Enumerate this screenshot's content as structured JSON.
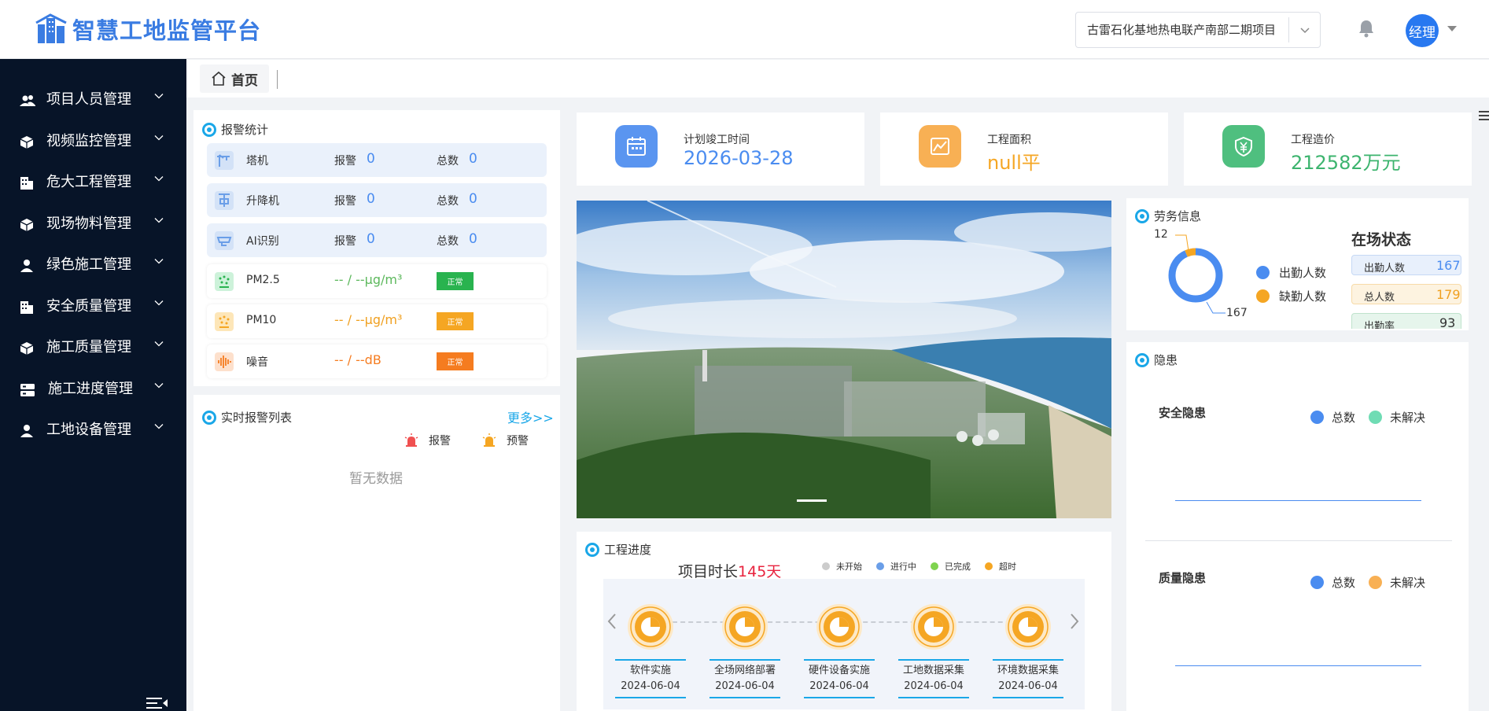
{
  "header": {
    "logo_text": "智慧工地监管平台",
    "project_name": "古雷石化基地热电联产南部二期项目",
    "user_avatar": "经理"
  },
  "sidebar": {
    "items": [
      {
        "label": "项目人员管理",
        "icon": "people-icon"
      },
      {
        "label": "视频监控管理",
        "icon": "cube-icon"
      },
      {
        "label": "危大工程管理",
        "icon": "building-icon"
      },
      {
        "label": "现场物料管理",
        "icon": "cube-icon"
      },
      {
        "label": "绿色施工管理",
        "icon": "person-icon"
      },
      {
        "label": "安全质量管理",
        "icon": "building-icon"
      },
      {
        "label": "施工质量管理",
        "icon": "cube-icon"
      },
      {
        "label": "施工进度管理",
        "icon": "server-icon"
      },
      {
        "label": "工地设备管理",
        "icon": "person-icon"
      }
    ]
  },
  "tabs": {
    "home": "首页"
  },
  "alarm_stats": {
    "title": "报警统计",
    "rows": [
      {
        "name": "塔机",
        "alarm_label": "报警",
        "alarm": "0",
        "total_label": "总数",
        "total": "0"
      },
      {
        "name": "升降机",
        "alarm_label": "报警",
        "alarm": "0",
        "total_label": "总数",
        "total": "0"
      },
      {
        "name": "AI识别",
        "alarm_label": "报警",
        "alarm": "0",
        "total_label": "总数",
        "total": "0"
      }
    ],
    "env": [
      {
        "name": "PM2.5",
        "value": "-- / --μg/m³",
        "status": "正常",
        "value_color": "#5cb85c",
        "badge_color": "#29b34f"
      },
      {
        "name": "PM10",
        "value": "-- / --μg/m³",
        "status": "正常",
        "value_color": "#f0a020",
        "badge_color": "#f5a623"
      },
      {
        "name": "噪音",
        "value": "-- / --dB",
        "status": "正常",
        "value_color": "#f57c20",
        "badge_color": "#f57c20"
      }
    ]
  },
  "realtime": {
    "title": "实时报警列表",
    "more": "更多>>",
    "legend_alarm": "报警",
    "legend_warn": "预警",
    "empty": "暂无数据"
  },
  "stats": [
    {
      "label": "计划竣工时间",
      "value": "2026-03-28",
      "color": "#4a8cf0"
    },
    {
      "label": "工程面积",
      "value": "null平",
      "color": "#f5a623"
    },
    {
      "label": "工程造价",
      "value": "212582万元",
      "color": "#3cb46e"
    }
  ],
  "labor": {
    "title": "劳务信息",
    "donut_top": "12",
    "donut_bottom": "167",
    "legend_present": "出勤人数",
    "legend_absent": "缺勤人数",
    "status_title": "在场状态",
    "rows": [
      {
        "label": "出勤人数",
        "value": "167"
      },
      {
        "label": "总人数",
        "value": "179"
      },
      {
        "label": "出勤率",
        "value": "93"
      }
    ],
    "chart_data": {
      "type": "pie",
      "categories": [
        "出勤人数",
        "缺勤人数"
      ],
      "values": [
        167,
        12
      ]
    }
  },
  "hazard": {
    "title": "隐患",
    "safety_label": "安全隐患",
    "quality_label": "质量隐患",
    "legend_total": "总数",
    "legend_unresolved": "未解决"
  },
  "progress": {
    "title": "工程进度",
    "duration_prefix": "项目时长",
    "duration_value": "145天",
    "legend": [
      "未开始",
      "进行中",
      "已完成",
      "超时"
    ],
    "steps": [
      {
        "name": "软件实施",
        "date": "2024-06-04"
      },
      {
        "name": "全场网络部署",
        "date": "2024-06-04"
      },
      {
        "name": "硬件设备实施",
        "date": "2024-06-04"
      },
      {
        "name": "工地数据采集",
        "date": "2024-06-04"
      },
      {
        "name": "环境数据采集",
        "date": "2024-06-04"
      }
    ]
  }
}
